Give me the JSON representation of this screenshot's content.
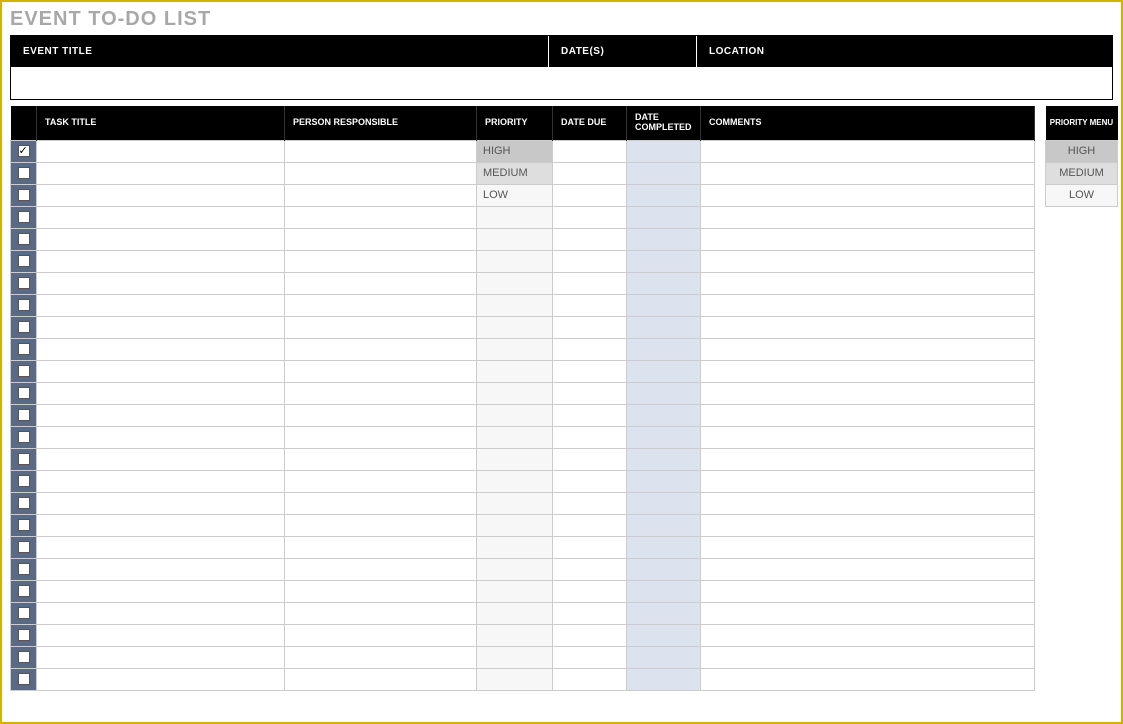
{
  "page_title": "EVENT TO-DO LIST",
  "event_header": {
    "title_label": "EVENT TITLE",
    "title_value": "",
    "dates_label": "DATE(S)",
    "dates_value": "",
    "location_label": "LOCATION",
    "location_value": ""
  },
  "columns": {
    "check": "",
    "task_title": "TASK TITLE",
    "person": "PERSON RESPONSIBLE",
    "priority": "PRIORITY",
    "due": "DATE DUE",
    "completed": "DATE COMPLETED",
    "comments": "COMMENTS"
  },
  "priority_menu": {
    "header": "PRIORITY MENU",
    "high": "HIGH",
    "medium": "MEDIUM",
    "low": "LOW"
  },
  "rows": [
    {
      "checked": true,
      "task": "",
      "person": "",
      "priority": "HIGH",
      "priority_class": "priority-high",
      "due": "",
      "completed": "",
      "comments": ""
    },
    {
      "checked": false,
      "task": "",
      "person": "",
      "priority": "MEDIUM",
      "priority_class": "priority-medium",
      "due": "",
      "completed": "",
      "comments": ""
    },
    {
      "checked": false,
      "task": "",
      "person": "",
      "priority": "LOW",
      "priority_class": "priority-low",
      "due": "",
      "completed": "",
      "comments": ""
    },
    {
      "checked": false,
      "task": "",
      "person": "",
      "priority": "",
      "priority_class": "",
      "due": "",
      "completed": "",
      "comments": ""
    },
    {
      "checked": false,
      "task": "",
      "person": "",
      "priority": "",
      "priority_class": "",
      "due": "",
      "completed": "",
      "comments": ""
    },
    {
      "checked": false,
      "task": "",
      "person": "",
      "priority": "",
      "priority_class": "",
      "due": "",
      "completed": "",
      "comments": ""
    },
    {
      "checked": false,
      "task": "",
      "person": "",
      "priority": "",
      "priority_class": "",
      "due": "",
      "completed": "",
      "comments": ""
    },
    {
      "checked": false,
      "task": "",
      "person": "",
      "priority": "",
      "priority_class": "",
      "due": "",
      "completed": "",
      "comments": ""
    },
    {
      "checked": false,
      "task": "",
      "person": "",
      "priority": "",
      "priority_class": "",
      "due": "",
      "completed": "",
      "comments": ""
    },
    {
      "checked": false,
      "task": "",
      "person": "",
      "priority": "",
      "priority_class": "",
      "due": "",
      "completed": "",
      "comments": ""
    },
    {
      "checked": false,
      "task": "",
      "person": "",
      "priority": "",
      "priority_class": "",
      "due": "",
      "completed": "",
      "comments": ""
    },
    {
      "checked": false,
      "task": "",
      "person": "",
      "priority": "",
      "priority_class": "",
      "due": "",
      "completed": "",
      "comments": ""
    },
    {
      "checked": false,
      "task": "",
      "person": "",
      "priority": "",
      "priority_class": "",
      "due": "",
      "completed": "",
      "comments": ""
    },
    {
      "checked": false,
      "task": "",
      "person": "",
      "priority": "",
      "priority_class": "",
      "due": "",
      "completed": "",
      "comments": ""
    },
    {
      "checked": false,
      "task": "",
      "person": "",
      "priority": "",
      "priority_class": "",
      "due": "",
      "completed": "",
      "comments": ""
    },
    {
      "checked": false,
      "task": "",
      "person": "",
      "priority": "",
      "priority_class": "",
      "due": "",
      "completed": "",
      "comments": ""
    },
    {
      "checked": false,
      "task": "",
      "person": "",
      "priority": "",
      "priority_class": "",
      "due": "",
      "completed": "",
      "comments": ""
    },
    {
      "checked": false,
      "task": "",
      "person": "",
      "priority": "",
      "priority_class": "",
      "due": "",
      "completed": "",
      "comments": ""
    },
    {
      "checked": false,
      "task": "",
      "person": "",
      "priority": "",
      "priority_class": "",
      "due": "",
      "completed": "",
      "comments": ""
    },
    {
      "checked": false,
      "task": "",
      "person": "",
      "priority": "",
      "priority_class": "",
      "due": "",
      "completed": "",
      "comments": ""
    },
    {
      "checked": false,
      "task": "",
      "person": "",
      "priority": "",
      "priority_class": "",
      "due": "",
      "completed": "",
      "comments": ""
    },
    {
      "checked": false,
      "task": "",
      "person": "",
      "priority": "",
      "priority_class": "",
      "due": "",
      "completed": "",
      "comments": ""
    },
    {
      "checked": false,
      "task": "",
      "person": "",
      "priority": "",
      "priority_class": "",
      "due": "",
      "completed": "",
      "comments": ""
    },
    {
      "checked": false,
      "task": "",
      "person": "",
      "priority": "",
      "priority_class": "",
      "due": "",
      "completed": "",
      "comments": ""
    },
    {
      "checked": false,
      "task": "",
      "person": "",
      "priority": "",
      "priority_class": "",
      "due": "",
      "completed": "",
      "comments": ""
    }
  ]
}
